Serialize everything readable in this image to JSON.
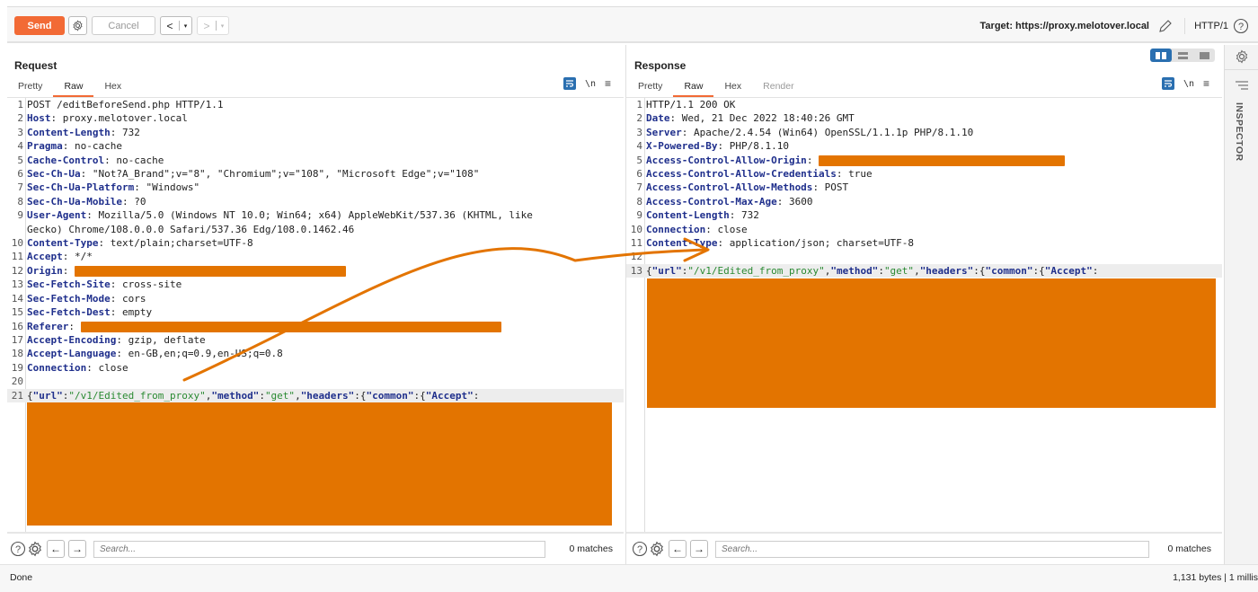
{
  "toolbar": {
    "send_label": "Send",
    "cancel_label": "Cancel",
    "back_glyph": "<",
    "forward_glyph": ">",
    "dropdown_glyph": "▾",
    "target_label": "Target: https://proxy.melotover.local",
    "protocol_label": "HTTP/1"
  },
  "request": {
    "title": "Request",
    "tabs": [
      {
        "label": "Pretty",
        "active": false
      },
      {
        "label": "Raw",
        "active": true
      },
      {
        "label": "Hex",
        "active": false
      }
    ],
    "newline_toggle": "\\n",
    "menu_glyph": "≡",
    "lines": [
      {
        "n": "1",
        "key": "",
        "value": "POST /editBeforeSend.php HTTP/1.1"
      },
      {
        "n": "2",
        "key": "Host",
        "value": ": proxy.melotover.local"
      },
      {
        "n": "3",
        "key": "Content-Length",
        "value": ": 732"
      },
      {
        "n": "4",
        "key": "Pragma",
        "value": ": no-cache"
      },
      {
        "n": "5",
        "key": "Cache-Control",
        "value": ": no-cache"
      },
      {
        "n": "6",
        "key": "Sec-Ch-Ua",
        "value": ": \"Not?A_Brand\";v=\"8\", \"Chromium\";v=\"108\", \"Microsoft Edge\";v=\"108\""
      },
      {
        "n": "7",
        "key": "Sec-Ch-Ua-Platform",
        "value": ": \"Windows\""
      },
      {
        "n": "8",
        "key": "Sec-Ch-Ua-Mobile",
        "value": ": ?0"
      },
      {
        "n": "9",
        "key": "User-Agent",
        "value": ": Mozilla/5.0 (Windows NT 10.0; Win64; x64) AppleWebKit/537.36 (KHTML, like"
      },
      {
        "n": "",
        "key": "",
        "value": "Gecko) Chrome/108.0.0.0 Safari/537.36 Edg/108.0.1462.46"
      },
      {
        "n": "10",
        "key": "Content-Type",
        "value": ": text/plain;charset=UTF-8"
      },
      {
        "n": "11",
        "key": "Accept",
        "value": ": */*"
      },
      {
        "n": "12",
        "key": "Origin",
        "value": ": ",
        "redacted": true
      },
      {
        "n": "13",
        "key": "Sec-Fetch-Site",
        "value": ": cross-site"
      },
      {
        "n": "14",
        "key": "Sec-Fetch-Mode",
        "value": ": cors"
      },
      {
        "n": "15",
        "key": "Sec-Fetch-Dest",
        "value": ": empty"
      },
      {
        "n": "16",
        "key": "Referer",
        "value": ": ",
        "redacted": true
      },
      {
        "n": "17",
        "key": "Accept-Encoding",
        "value": ": gzip, deflate"
      },
      {
        "n": "18",
        "key": "Accept-Language",
        "value": ": en-GB,en;q=0.9,en-US;q=0.8"
      },
      {
        "n": "19",
        "key": "Connection",
        "value": ": close"
      },
      {
        "n": "20",
        "key": "",
        "value": ""
      }
    ],
    "body_line": {
      "n": "21",
      "url_key": "\"url\"",
      "url_val": "\"/v1/Edited_from_proxy\"",
      "method_key": "\"method\"",
      "method_val": "\"get\"",
      "headers_key": "\"headers\"",
      "common_key": "\"common\"",
      "accept_key": "\"Accept\""
    },
    "search_placeholder": "Search...",
    "matches": "0 matches"
  },
  "response": {
    "title": "Response",
    "tabs": [
      {
        "label": "Pretty",
        "active": false
      },
      {
        "label": "Raw",
        "active": true
      },
      {
        "label": "Hex",
        "active": false
      },
      {
        "label": "Render",
        "active": false,
        "disabled": true
      }
    ],
    "newline_toggle": "\\n",
    "menu_glyph": "≡",
    "lines": [
      {
        "n": "1",
        "key": "",
        "value": "HTTP/1.1 200 OK"
      },
      {
        "n": "2",
        "key": "Date",
        "value": ": Wed, 21 Dec 2022 18:40:26 GMT"
      },
      {
        "n": "3",
        "key": "Server",
        "value": ": Apache/2.4.54 (Win64) OpenSSL/1.1.1p PHP/8.1.10"
      },
      {
        "n": "4",
        "key": "X-Powered-By",
        "value": ": PHP/8.1.10"
      },
      {
        "n": "5",
        "key": "Access-Control-Allow-Origin",
        "value": ": ",
        "redacted": true
      },
      {
        "n": "6",
        "key": "Access-Control-Allow-Credentials",
        "value": ": true"
      },
      {
        "n": "7",
        "key": "Access-Control-Allow-Methods",
        "value": ": POST"
      },
      {
        "n": "8",
        "key": "Access-Control-Max-Age",
        "value": ": 3600"
      },
      {
        "n": "9",
        "key": "Content-Length",
        "value": ": 732"
      },
      {
        "n": "10",
        "key": "Connection",
        "value": ": close"
      },
      {
        "n": "11",
        "key": "Content-Type",
        "value": ": application/json; charset=UTF-8"
      },
      {
        "n": "12",
        "key": "",
        "value": ""
      }
    ],
    "body_line": {
      "n": "13",
      "url_key": "\"url\"",
      "url_val": "\"/v1/Edited_from_proxy\"",
      "method_key": "\"method\"",
      "method_val": "\"get\"",
      "headers_key": "\"headers\"",
      "common_key": "\"common\"",
      "accept_key": "\"Accept\""
    },
    "search_placeholder": "Search...",
    "matches": "0 matches"
  },
  "sidebar": {
    "inspector_label": "INSPECTOR"
  },
  "status": {
    "left": "Done",
    "right": "1,131 bytes | 1 millis"
  },
  "colors": {
    "accent": "#f26a35",
    "redaction": "#e37400",
    "key": "#1f2f8c",
    "string": "#2a8a32",
    "toggle_active": "#2a6fb0"
  }
}
